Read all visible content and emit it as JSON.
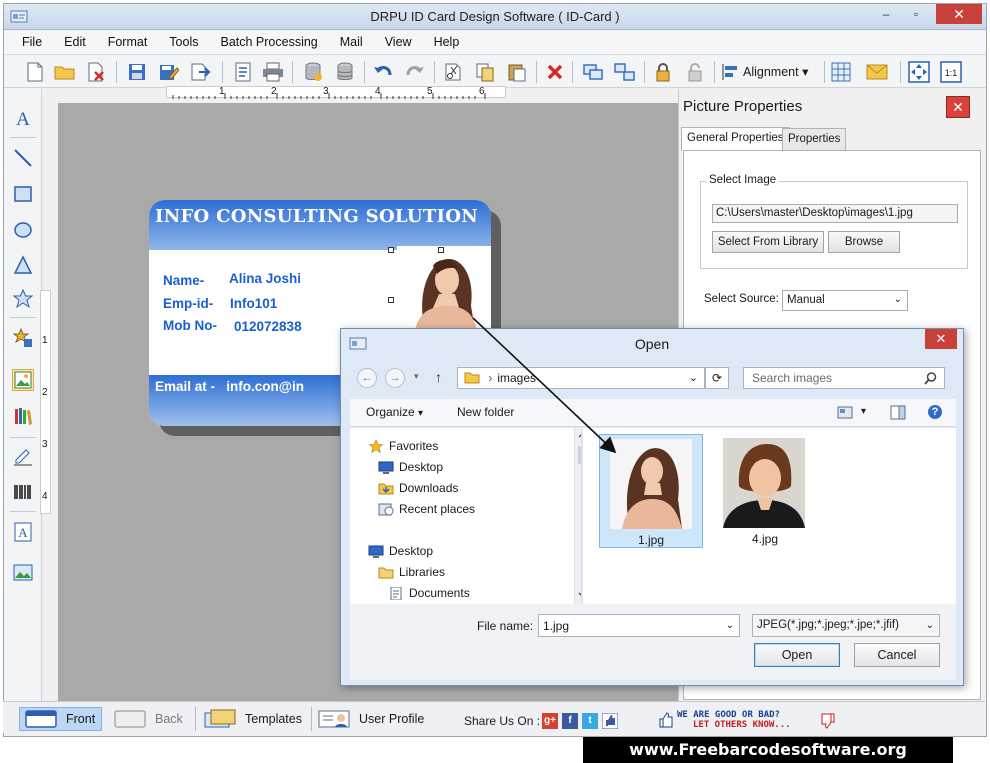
{
  "window": {
    "title": "DRPU ID Card Design Software ( ID-Card )",
    "minimize_glyph": "–",
    "maximize_glyph": "▫",
    "close_glyph": "✕"
  },
  "menu": [
    "File",
    "Edit",
    "Format",
    "Tools",
    "Batch Processing",
    "Mail",
    "View",
    "Help"
  ],
  "toolbar": {
    "alignment_label": "Alignment",
    "dropdown_glyph": "▾"
  },
  "ruler_h": [
    "1",
    "2",
    "3",
    "4",
    "5",
    "6"
  ],
  "ruler_v": [
    "1",
    "2",
    "3",
    "4"
  ],
  "card": {
    "company": "INFO CONSULTING SOLUTION",
    "name_label": "Name-",
    "name_value": "Alina Joshi",
    "empid_label": "Emp-id-",
    "empid_value": "Info101",
    "mob_label": "Mob No-",
    "mob_value": "012072838",
    "email_label": "Email at -",
    "email_value": "info.con@in"
  },
  "panel": {
    "title": "Picture Properties",
    "close_glyph": "✕",
    "tabs": [
      "General Properties",
      "Properties"
    ],
    "select_image_label": "Select Image",
    "path": "C:\\Users\\master\\Desktop\\images\\1.jpg",
    "select_from_library": "Select From Library",
    "browse": "Browse",
    "select_source_label": "Select Source:",
    "select_source_value": "Manual",
    "dropdown_glyph": "⌄"
  },
  "dialog": {
    "title": "Open",
    "close_glyph": "✕",
    "back_glyph": "←",
    "forward_glyph": "→",
    "up_glyph": "↑",
    "refresh_glyph": "⟳",
    "breadcrumb_separator": "›",
    "address": "images",
    "search_placeholder": "Search images",
    "organize": "Organize",
    "new_folder": "New folder",
    "help_glyph": "?",
    "dropdown_glyph": "▾",
    "tree": {
      "favorites": "Favorites",
      "desktop": "Desktop",
      "downloads": "Downloads",
      "recent_places": "Recent places",
      "desktop2": "Desktop",
      "libraries": "Libraries",
      "documents": "Documents"
    },
    "files": [
      "1.jpg",
      "4.jpg"
    ],
    "file_name_label": "File name:",
    "file_name_value": "1.jpg",
    "file_type": "JPEG(*.jpg;*.jpeg;*.jpe;*.jfif)",
    "open_button": "Open",
    "cancel_button": "Cancel"
  },
  "bottombar": {
    "front": "Front",
    "back": "Back",
    "templates": "Templates",
    "user_profile": "User Profile",
    "share_label": "Share Us On :",
    "feedback_line1": "WE ARE GOOD OR BAD?",
    "feedback_line2": "LET OTHERS KNOW..."
  },
  "watermark": "www.Freebarcodesoftware.org",
  "colors": {
    "accent_blue": "#2f6ed3",
    "close_red": "#c7403a",
    "canvas_gray": "#a9a9a9",
    "selection": "#cde6fa"
  }
}
